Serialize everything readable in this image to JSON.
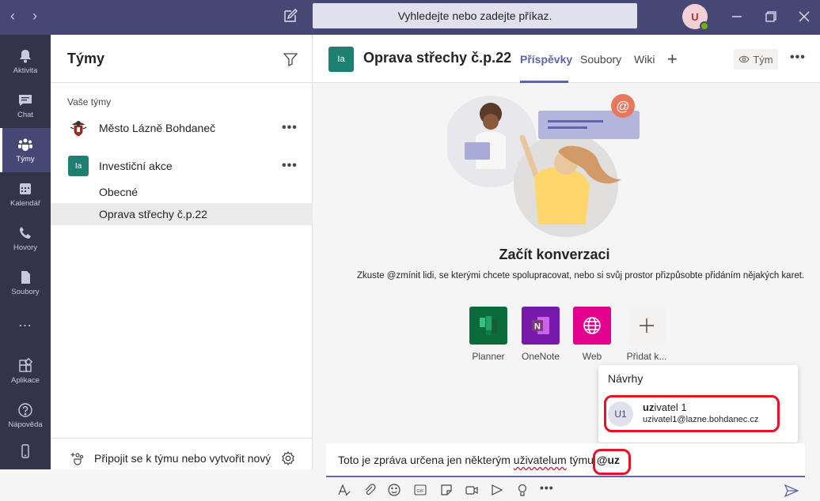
{
  "app": {
    "search_placeholder": "Vyhledejte nebo zadejte příkaz.",
    "user_initials": "U"
  },
  "rail": {
    "items": [
      {
        "label": "Aktivita",
        "icon": "bell-icon"
      },
      {
        "label": "Chat",
        "icon": "chat-icon"
      },
      {
        "label": "Týmy",
        "icon": "teams-icon"
      },
      {
        "label": "Kalendář",
        "icon": "calendar-icon"
      },
      {
        "label": "Hovory",
        "icon": "phone-icon"
      },
      {
        "label": "Soubory",
        "icon": "file-icon"
      },
      {
        "label": "…",
        "icon": "more-icon"
      },
      {
        "label": "Aplikace",
        "icon": "apps-icon"
      },
      {
        "label": "Nápověda",
        "icon": "help-icon"
      }
    ],
    "active": "Týmy"
  },
  "teams_panel": {
    "title": "Týmy",
    "section_label": "Vaše týmy",
    "teams": [
      {
        "name": "Město Lázně Bohdaneč",
        "more": "•••"
      },
      {
        "name": "Investiční akce",
        "initials": "Ia",
        "more": "•••",
        "channels": [
          "Obecné",
          "Oprava střechy č.p.22"
        ]
      }
    ],
    "selected_channel": "Oprava střechy č.p.22",
    "join_label": "Připojit se k týmu nebo vytvořit nový"
  },
  "channel": {
    "logo_initials": "Ia",
    "title": "Oprava střechy č.p.22",
    "tabs": [
      "Příspěvky",
      "Soubory",
      "Wiki"
    ],
    "active_tab": "Příspěvky",
    "add_tab": "+",
    "team_button": "Tým",
    "more": "•••"
  },
  "empty_state": {
    "title": "Začít konverzaci",
    "subtitle": "Zkuste @zmínit lidi, se kterými chcete spolupracovat, nebo si svůj prostor přizpůsobte přidáním nějakých karet."
  },
  "apps": [
    {
      "label": "Planner",
      "color": "#0b6a3a",
      "icon": "planner-icon"
    },
    {
      "label": "OneNote",
      "color": "#7719aa",
      "icon": "onenote-icon"
    },
    {
      "label": "Web",
      "color": "#e3008c",
      "icon": "globe-icon"
    },
    {
      "label": "Přidat k...",
      "color": "#f3f2f1",
      "icon": "plus-icon"
    }
  ],
  "suggestions": {
    "title": "Návrhy",
    "items": [
      {
        "initials": "U1",
        "name_match": "uz",
        "name_rest": "ivatel 1",
        "email": "uzivatel1@lazne.bohdanec.cz"
      }
    ]
  },
  "compose": {
    "text_before": "Toto je zpráva určena jen některým ",
    "text_misspelled": "uživatelum",
    "text_after": " týmu ",
    "mention": "@uz"
  },
  "colors": {
    "titlebar": "#464775",
    "rail": "#33344a",
    "accent": "#6264a7",
    "highlight": "#e81123"
  }
}
